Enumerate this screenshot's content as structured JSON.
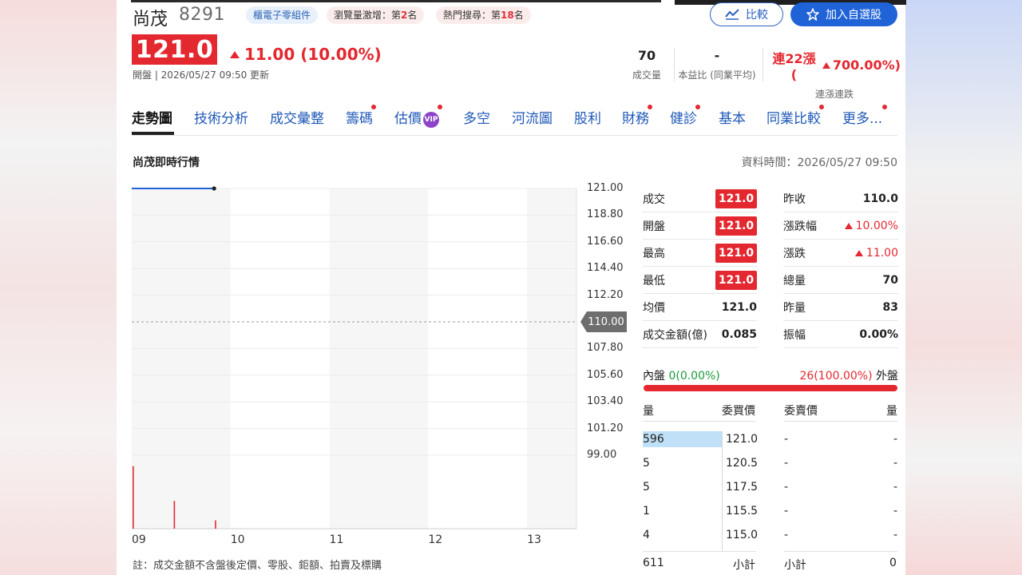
{
  "stock": {
    "name": "尚茂",
    "code": "8291",
    "tags": [
      {
        "label": "櫃電子零組件"
      },
      {
        "pre": "瀏覽量激增：第",
        "num": "2",
        "post": "名"
      },
      {
        "pre": "熱門搜尋：第",
        "num": "18",
        "post": "名"
      }
    ],
    "price": "121.0",
    "change": "11.00 (10.00%)",
    "session": "開盤 | 2026/05/27 09:50 更新"
  },
  "actions": {
    "compare": "比較",
    "watchlist": "加入自選股"
  },
  "summary": {
    "volume": {
      "value": "70",
      "label": "成交量"
    },
    "pe": {
      "value": "-",
      "label": "本益比 (同業平均)"
    },
    "streak": {
      "value": "連22漲 (",
      "pct": "700.00%)",
      "label": "連漲連跌"
    }
  },
  "tabs": [
    {
      "label": "走勢圖",
      "active": true,
      "dot": false
    },
    {
      "label": "技術分析",
      "dot": false
    },
    {
      "label": "成交彙整",
      "dot": false
    },
    {
      "label": "籌碼",
      "dot": true
    },
    {
      "label": "估價",
      "dot": true,
      "vip": "VIP"
    },
    {
      "label": "多空",
      "dot": false
    },
    {
      "label": "河流圖",
      "dot": false
    },
    {
      "label": "股利",
      "dot": false
    },
    {
      "label": "財務",
      "dot": true
    },
    {
      "label": "健診",
      "dot": true
    },
    {
      "label": "基本",
      "dot": false
    },
    {
      "label": "同業比較",
      "dot": true
    },
    {
      "label": "更多...",
      "dot": true
    }
  ],
  "section": {
    "title": "尚茂即時行情",
    "data_time": "資料時間：2026/05/27 09:50"
  },
  "chart_data": {
    "type": "line",
    "y_ticks": [
      "121.00",
      "118.80",
      "116.60",
      "114.40",
      "112.20",
      "110.00",
      "107.80",
      "105.60",
      "103.40",
      "101.20",
      "99.00"
    ],
    "ylim": [
      99.0,
      121.0
    ],
    "x_ticks": [
      "09",
      "10",
      "11",
      "12",
      "13"
    ],
    "prev_close": "110.00",
    "series": [
      {
        "x": [
          "09:00",
          "09:50"
        ],
        "y": [
          121.0,
          121.0
        ]
      }
    ],
    "volume_bars": [
      {
        "x": "09:00",
        "rel": 0.9
      },
      {
        "x": "09:25",
        "rel": 0.4
      },
      {
        "x": "09:50",
        "rel": 0.12
      }
    ]
  },
  "quote": {
    "left": [
      {
        "label": "成交",
        "value": "121.0",
        "boxed": true
      },
      {
        "label": "開盤",
        "value": "121.0",
        "boxed": true
      },
      {
        "label": "最高",
        "value": "121.0",
        "boxed": true
      },
      {
        "label": "最低",
        "value": "121.0",
        "boxed": true
      },
      {
        "label": "均價",
        "value": "121.0"
      },
      {
        "label": "成交金額(億)",
        "value": "0.085"
      }
    ],
    "right": [
      {
        "label": "昨收",
        "value": "110.0"
      },
      {
        "label": "漲跌幅",
        "value": "10.00%",
        "up": true
      },
      {
        "label": "漲跌",
        "value": "11.00",
        "up": true
      },
      {
        "label": "總量",
        "value": "70"
      },
      {
        "label": "昨量",
        "value": "83"
      },
      {
        "label": "振幅",
        "value": "0.00%"
      }
    ]
  },
  "inout": {
    "inner_label": "內盤",
    "inner_value": "0(0.00%)",
    "outer_value": "26(100.00%)",
    "outer_label": "外盤",
    "inner_ratio": 0.0
  },
  "orderbook": {
    "headers": {
      "qty": "量",
      "bid": "委買價",
      "ask": "委賣價",
      "ask_qty": "量"
    },
    "rows": [
      {
        "qty": "596",
        "bid": "121.0",
        "ask": "-",
        "ask_qty": "-"
      },
      {
        "qty": "5",
        "bid": "120.5",
        "ask": "-",
        "ask_qty": "-"
      },
      {
        "qty": "5",
        "bid": "117.5",
        "ask": "-",
        "ask_qty": "-"
      },
      {
        "qty": "1",
        "bid": "115.5",
        "ask": "-",
        "ask_qty": "-"
      },
      {
        "qty": "4",
        "bid": "115.0",
        "ask": "-",
        "ask_qty": "-"
      }
    ],
    "footer": {
      "bid_total": "611",
      "bid_label": "小計",
      "ask_label": "小計",
      "ask_total": "0"
    },
    "top_qty_ratio": 1.0
  },
  "note": "註：成交金額不含盤後定價、零股、鉅額、拍賣及標購",
  "colors": {
    "up": "#e4282f",
    "down": "#1a9a3c",
    "link": "#1f58b8",
    "accent": "#1f63d6"
  }
}
